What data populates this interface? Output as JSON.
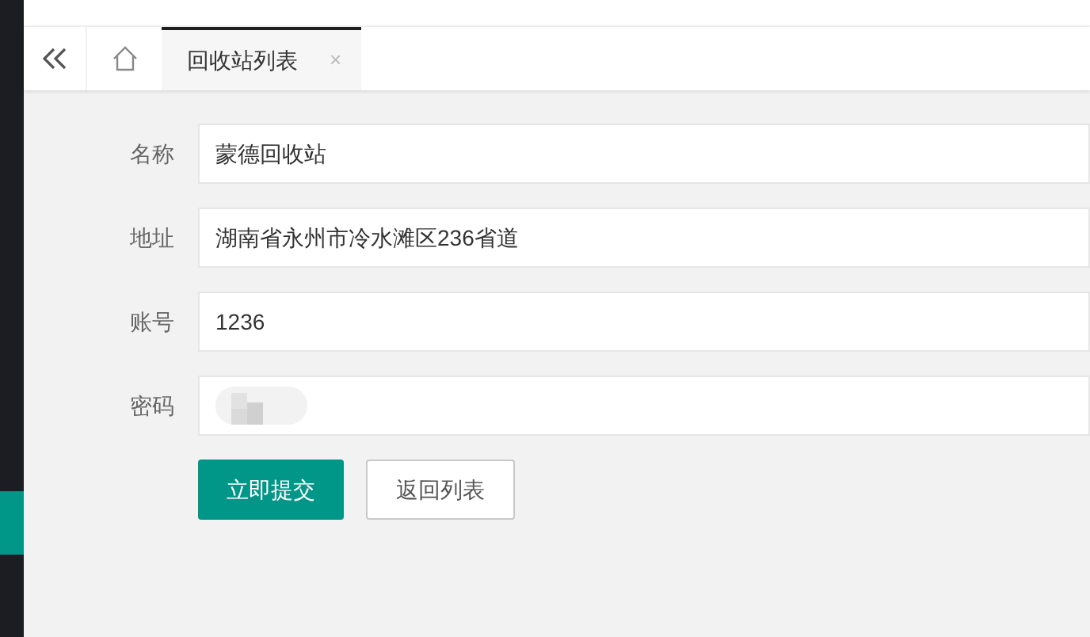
{
  "tabs": [
    {
      "label": "回收站列表",
      "selected": true,
      "close": "×"
    }
  ],
  "form": {
    "fields": [
      {
        "label": "名称",
        "value": "蒙德回收站"
      },
      {
        "label": "地址",
        "value": "湖南省永州市冷水滩区236省道"
      },
      {
        "label": "账号",
        "value": "1236"
      },
      {
        "label": "密码",
        "kind": "masked"
      }
    ],
    "buttons": [
      {
        "label": "立即提交",
        "kind": "primary"
      },
      {
        "label": "返回列表",
        "kind": "plain"
      }
    ]
  }
}
